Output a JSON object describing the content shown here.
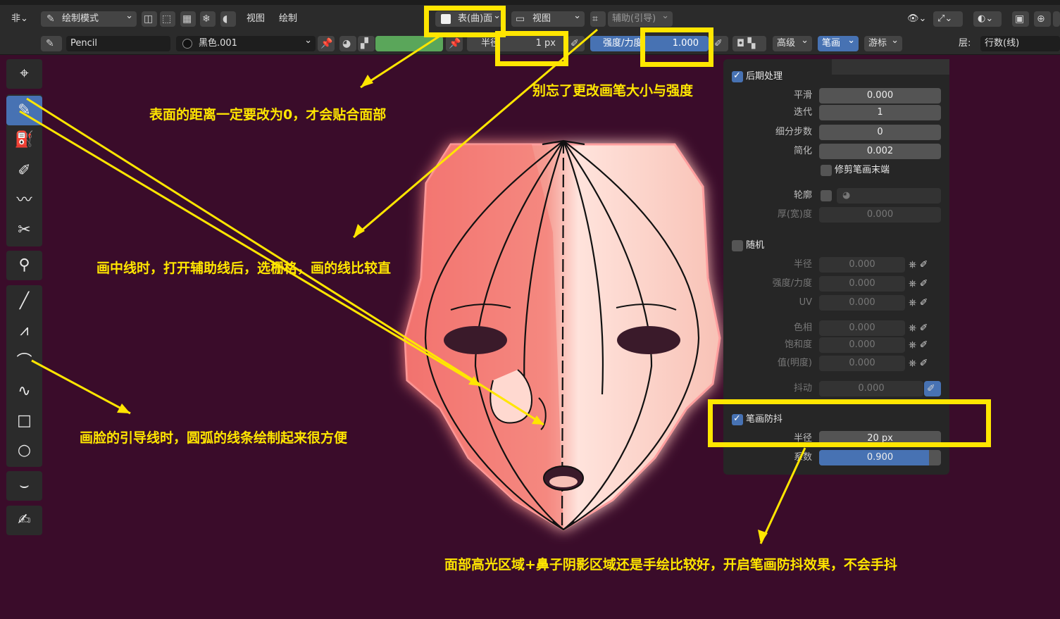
{
  "header": {
    "mode": "绘制模式",
    "menus": [
      "视图",
      "绘制"
    ],
    "stroke_placement": "表(曲)面",
    "orientation": "视图",
    "guides": "辅助(引导)"
  },
  "toolsettings": {
    "brush_name": "Pencil",
    "material_name": "黑色.001",
    "radius_label": "半径",
    "radius_value": "1 px",
    "strength_label": "强度/力度",
    "strength_value": "1.000",
    "advanced": "高级",
    "stroke": "笔画",
    "cursor": "游标",
    "layer_label": "层:",
    "layer_value": "行数(线)"
  },
  "panel": {
    "post_processing": "后期处理",
    "smooth_label": "平滑",
    "smooth_value": "0.000",
    "iterations_label": "迭代",
    "iterations_value": "1",
    "subdivisions_label": "细分步数",
    "subdivisions_value": "0",
    "simplify_label": "简化",
    "simplify_value": "0.002",
    "trim_label": "修剪笔画末端",
    "outline_label": "轮廓",
    "thickness_label": "厚(宽)度",
    "thickness_value": "0.000",
    "randomize": "随机",
    "rand_radius_label": "半径",
    "rand_radius_value": "0.000",
    "rand_strength_label": "强度/力度",
    "rand_strength_value": "0.000",
    "rand_uv_label": "UV",
    "rand_uv_value": "0.000",
    "hue_label": "色相",
    "hue_value": "0.000",
    "saturation_label": "饱和度",
    "saturation_value": "0.000",
    "value_label": "值(明度)",
    "value_value": "0.000",
    "jitter_label": "抖动",
    "jitter_value": "0.000",
    "stabilize": "笔画防抖",
    "stab_radius_label": "半径",
    "stab_radius_value": "20 px",
    "stab_factor_label": "系数",
    "stab_factor_value": "0.900",
    "stab_factor_fraction": 0.9
  },
  "annotations": {
    "surface": "表面的距离一定要改为0，才会贴合面部",
    "brush": "别忘了更改画笔大小与强度",
    "midline": "画中线时，打开辅助线后，选栅格，画的线比较直",
    "arc": "画脸的引导线时，圆弧的线条绘制起来很方便",
    "highlight": "面部高光区域+鼻子阴影区域还是手绘比较好，开启笔画防抖效果，不会手抖"
  },
  "colors": {
    "accent": "#4772b3",
    "annotation": "#ffe600",
    "viewport": "#3a0c2a"
  }
}
